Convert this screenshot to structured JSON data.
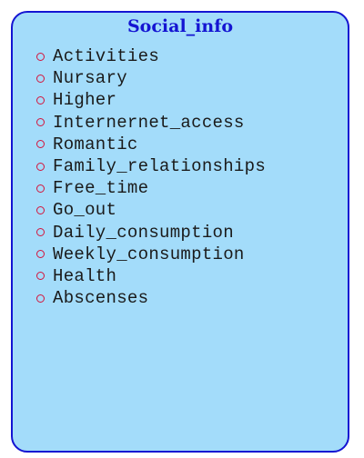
{
  "entity": {
    "title": "Social_info",
    "attributes": [
      "Activities",
      "Nursary",
      "Higher",
      "Internernet_access",
      "Romantic",
      "Family_relationships",
      "Free_time",
      "Go_out",
      "Daily_consumption",
      "Weekly_consumption",
      "Health",
      "Abscenses"
    ]
  },
  "colors": {
    "fill": "#a3dcfa",
    "border": "#1414d2",
    "title": "#1414d2",
    "bullet": "#d4143c"
  }
}
